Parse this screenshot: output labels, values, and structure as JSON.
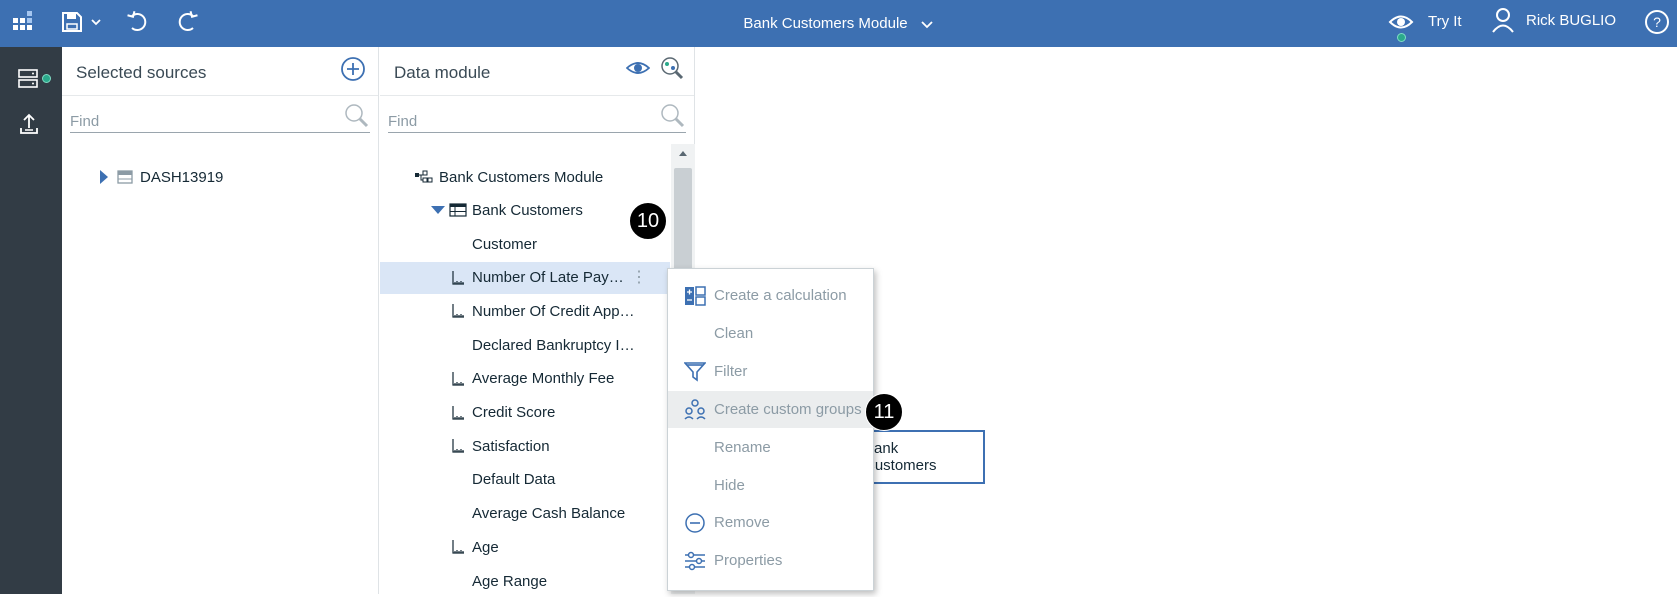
{
  "header": {
    "module_title": "Bank Customers Module",
    "try_it": "Try It",
    "user_name": "Rick BUGLIO",
    "accent": "#3d70b2"
  },
  "icons": {
    "app_logo": "app-logo-icon",
    "save": "save-icon",
    "undo": "undo-icon",
    "redo": "redo-icon",
    "eye": "eye-icon",
    "user": "user-icon",
    "help": "help-icon"
  },
  "sources_panel": {
    "title": "Selected sources",
    "find_placeholder": "Find",
    "items": [
      {
        "label": "DASH13919"
      }
    ]
  },
  "module_panel": {
    "title": "Data module",
    "find_placeholder": "Find",
    "root": "Bank Customers Module",
    "table": "Bank Customers",
    "fields": [
      {
        "label": "Customer",
        "icon": "none"
      },
      {
        "label": "Number Of Late Pay…",
        "icon": "measure-icon",
        "selected": true
      },
      {
        "label": "Number Of Credit App…",
        "icon": "measure-icon"
      },
      {
        "label": "Declared Bankruptcy I…",
        "icon": "none"
      },
      {
        "label": "Average Monthly Fee",
        "icon": "measure-icon"
      },
      {
        "label": "Credit Score",
        "icon": "measure-icon"
      },
      {
        "label": "Satisfaction",
        "icon": "measure-icon"
      },
      {
        "label": "Default Data",
        "icon": "none"
      },
      {
        "label": "Average Cash Balance",
        "icon": "none"
      },
      {
        "label": "Age",
        "icon": "measure-icon"
      },
      {
        "label": "Age Range",
        "icon": "none"
      }
    ]
  },
  "context_menu": {
    "items": [
      {
        "label": "Create a calculation",
        "icon": "calculation-icon"
      },
      {
        "label": "Clean",
        "icon": "none"
      },
      {
        "label": "Filter",
        "icon": "filter-icon"
      },
      {
        "label": "Create custom groups",
        "icon": "custom-groups-icon",
        "highlighted": true
      },
      {
        "label": "Rename",
        "icon": "none"
      },
      {
        "label": "Hide",
        "icon": "none"
      },
      {
        "label": "Remove",
        "icon": "remove-icon"
      },
      {
        "label": "Properties",
        "icon": "properties-icon"
      }
    ]
  },
  "badges": {
    "step_10": "10",
    "step_11": "11"
  },
  "canvas": {
    "node_label": "Bank Customers"
  }
}
